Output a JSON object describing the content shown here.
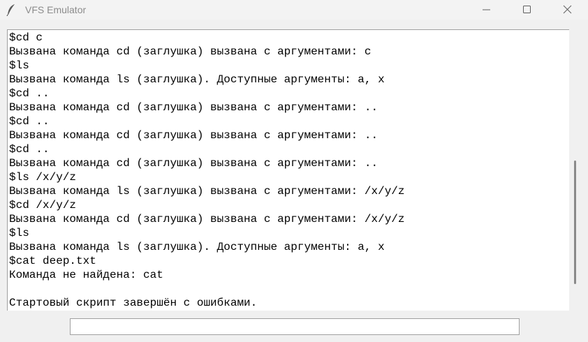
{
  "window": {
    "title": "VFS Emulator",
    "icon": "feather-icon"
  },
  "titlebar_buttons": [
    "minimize",
    "maximize",
    "close"
  ],
  "output": {
    "lines": [
      "$cd c",
      "Вызвана команда cd (заглушка) вызвана с аргументами: c",
      "$ls",
      "Вызвана команда ls (заглушка). Доступные аргументы: a, x",
      "$cd ..",
      "Вызвана команда cd (заглушка) вызвана с аргументами: ..",
      "$cd ..",
      "Вызвана команда cd (заглушка) вызвана с аргументами: ..",
      "$cd ..",
      "Вызвана команда cd (заглушка) вызвана с аргументами: ..",
      "$ls /x/y/z",
      "Вызвана команда ls (заглушка) вызвана с аргументами: /x/y/z",
      "$cd /x/y/z",
      "Вызвана команда cd (заглушка) вызвана с аргументами: /x/y/z",
      "$ls",
      "Вызвана команда ls (заглушка). Доступные аргументы: a, x",
      "$cat deep.txt",
      "Команда не найдена: cat",
      "",
      "Стартовый скрипт завершён с ошибками."
    ]
  },
  "input": {
    "value": ""
  }
}
